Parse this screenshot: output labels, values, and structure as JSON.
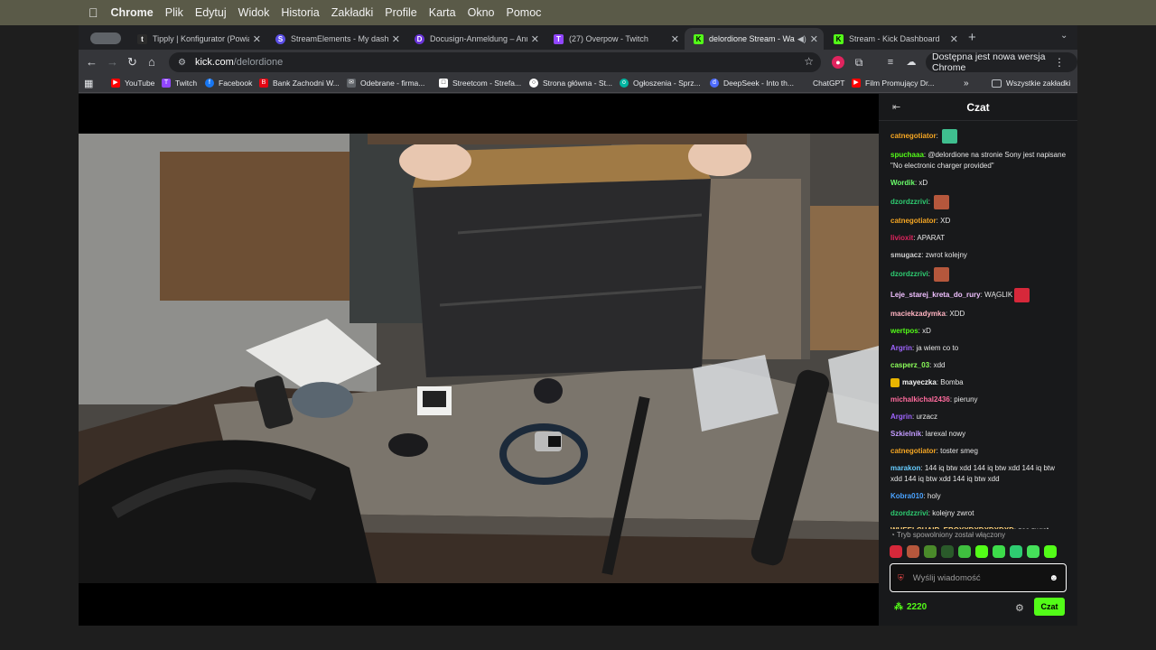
{
  "os_menubar": {
    "items": [
      "Chrome",
      "Plik",
      "Edytuj",
      "Widok",
      "Historia",
      "Zakładki",
      "Profile",
      "Karta",
      "Okno",
      "Pomoc"
    ]
  },
  "tabs": [
    {
      "label": "Tipply | Konfigurator (Powiadc",
      "icon": "tipply-icon",
      "color": "#2b2b2b"
    },
    {
      "label": "StreamElements - My dashbo",
      "icon": "streamelements-icon",
      "color": "#5b4ee6"
    },
    {
      "label": "Docusign-Anmeldung – Anm",
      "icon": "docusign-icon",
      "color": "#6a34d9"
    },
    {
      "label": "(27) Overpow - Twitch",
      "icon": "twitch-icon",
      "color": "#9146ff"
    },
    {
      "label": "delordione Stream - Watc",
      "icon": "kick-icon",
      "color": "#53fc18",
      "active": true
    },
    {
      "label": "Stream - Kick Dashboard",
      "icon": "kick-icon",
      "color": "#53fc18"
    }
  ],
  "address": {
    "host": "kick.com",
    "path": "/delordione"
  },
  "update_button": "Dostępna jest nowa wersja Chrome",
  "bookmarks": [
    {
      "label": "YouTube",
      "color": "#ff0000"
    },
    {
      "label": "Twitch",
      "color": "#9146ff"
    },
    {
      "label": "Facebook",
      "color": "#1877f2"
    },
    {
      "label": "Bank Zachodni W...",
      "color": "#e30613"
    },
    {
      "label": "Odebrane - firma...",
      "color": "#dadce0"
    },
    {
      "label": "Streetcom - Strefa...",
      "color": "#ffffff"
    },
    {
      "label": "Strona główna - St...",
      "color": "#ffffff"
    },
    {
      "label": "Ogłoszenia - Sprz...",
      "color": "#00b4a0"
    },
    {
      "label": "DeepSeek - Into th...",
      "color": "#4d6bfe"
    },
    {
      "label": "ChatGPT",
      "color": "#35363a"
    },
    {
      "label": "Film Promujący Dr...",
      "color": "#ff0000"
    }
  ],
  "all_bookmarks": "Wszystkie zakładki",
  "chat": {
    "title": "Czat",
    "messages": [
      {
        "user": "catnegotiator",
        "color": "#f5a623",
        "text": "",
        "emote": "#3fbf8f"
      },
      {
        "user": "spuchaaa",
        "color": "#53fc18",
        "text": "@delordione na stronie Sony jest napisane \"No electronic charger provided\""
      },
      {
        "user": "Wordik",
        "color": "#6bff6b",
        "text": "xD"
      },
      {
        "user": "dzordzzrivi",
        "color": "#2ecc71",
        "text": "",
        "emote": "#b5573c"
      },
      {
        "user": "catnegotiator",
        "color": "#f5a623",
        "text": "XD"
      },
      {
        "user": "livioxit",
        "color": "#e0245e",
        "text": "APARAT"
      },
      {
        "user": "smugacz",
        "color": "#cfcfcf",
        "text": "zwrot kolejny"
      },
      {
        "user": "dzordzzrivi",
        "color": "#2ecc71",
        "text": "",
        "emote": "#b5573c"
      },
      {
        "user": "Leje_starej_kreta_do_rury",
        "color": "#f0c0ff",
        "text": "WĄGLIK",
        "emote": "#d6283a"
      },
      {
        "user": "maciekzadymka",
        "color": "#ffb3c1",
        "text": "XDD"
      },
      {
        "user": "wertpos",
        "color": "#53fc18",
        "text": "xD"
      },
      {
        "user": "Argrin",
        "color": "#a064ff",
        "text": "ja wiem co to"
      },
      {
        "user": "casperz_03",
        "color": "#8cff5a",
        "text": "xdd"
      },
      {
        "user": "mayeczka",
        "color": "#f5f5f5",
        "text": "Bomba",
        "badge": true
      },
      {
        "user": "michalkichal2436",
        "color": "#ff6b9d",
        "text": "pieruny"
      },
      {
        "user": "Argrin",
        "color": "#a064ff",
        "text": "urzacz"
      },
      {
        "user": "Szkielnik",
        "color": "#c39bff",
        "text": "larexal nowy"
      },
      {
        "user": "catnegotiator",
        "color": "#f5a623",
        "text": "toster smeg"
      },
      {
        "user": "marakon",
        "color": "#66ccff",
        "text": "144 iq btw xdd 144 iq btw xdd 144 iq btw xdd 144 iq btw xdd 144 iq btw xdd"
      },
      {
        "user": "Kobra010",
        "color": "#4aa3ff",
        "text": "holy"
      },
      {
        "user": "dzordzzrivi",
        "color": "#2ecc71",
        "text": "kolejny zwrot"
      },
      {
        "user": "WHEELCHAIR_EBOYXDXDXDXDXD",
        "color": "#ffd27a",
        "text": "zas zwrot",
        "emote": "#e39a7a",
        "emote_newline": true
      }
    ],
    "slow_mode": "Tryb spowolniony został włączony",
    "input_placeholder": "Wyślij wiadomość",
    "points": "2220",
    "send_label": "Czat"
  },
  "colors": {
    "accent": "#53fc18",
    "chat_bg": "#18191b",
    "page_bg": "#000000"
  }
}
